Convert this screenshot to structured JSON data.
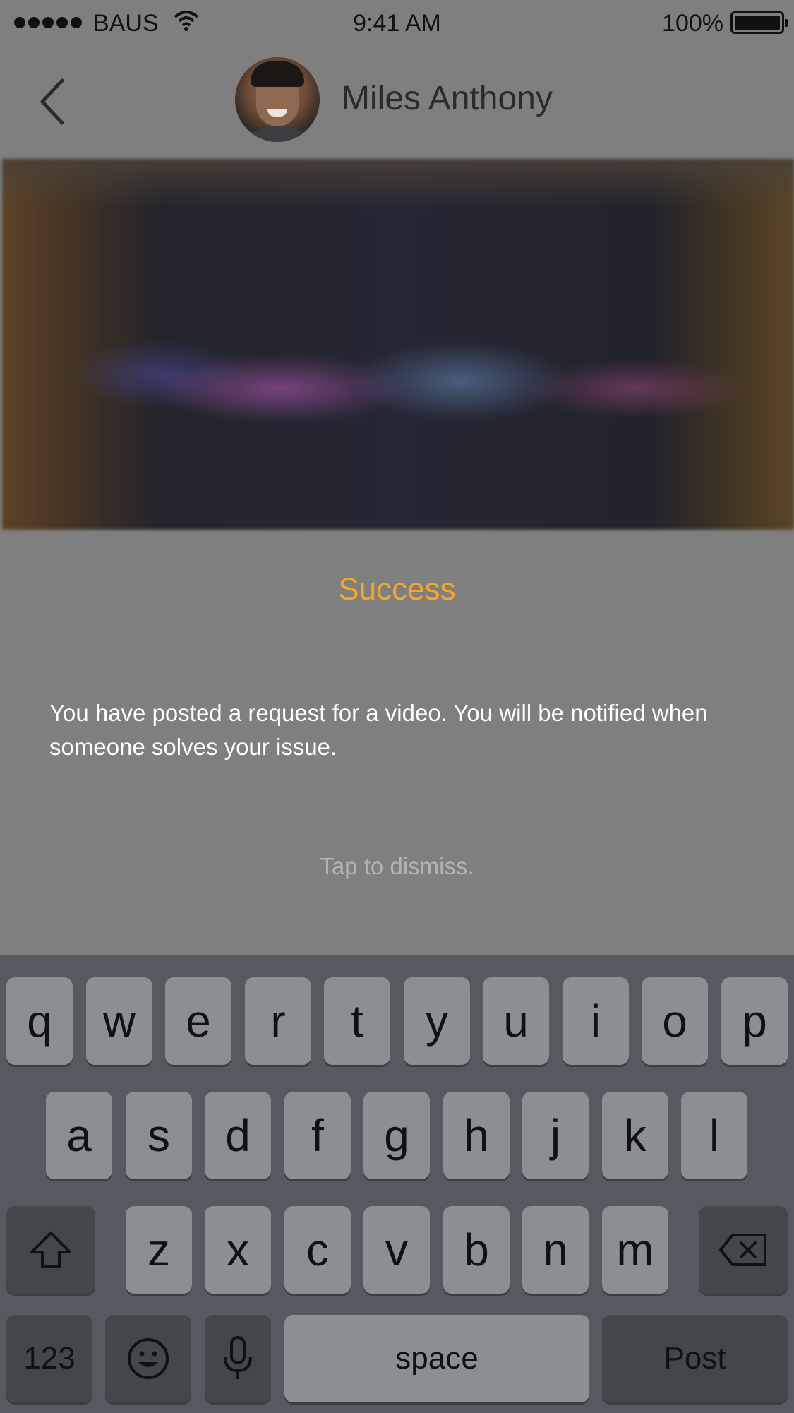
{
  "status_bar": {
    "carrier": "BAUS",
    "time": "9:41 AM",
    "battery_percent": "100%"
  },
  "nav": {
    "back_icon": "chevron-left-icon",
    "contact_name": "Miles Anthony"
  },
  "alert": {
    "title": "Success",
    "message": "You have posted a request for a video. You will be notified when someone solves your issue.",
    "dismiss_hint": "Tap to dismiss.",
    "title_color": "#f6a62a"
  },
  "keyboard": {
    "row1": [
      "q",
      "w",
      "e",
      "r",
      "t",
      "y",
      "u",
      "i",
      "o",
      "p"
    ],
    "row2": [
      "a",
      "s",
      "d",
      "f",
      "g",
      "h",
      "j",
      "k",
      "l"
    ],
    "row3": [
      "z",
      "x",
      "c",
      "v",
      "b",
      "n",
      "m"
    ],
    "numbers_label": "123",
    "space_label": "space",
    "return_label": "Post",
    "shift_icon": "shift-icon",
    "delete_icon": "backspace-icon",
    "emoji_icon": "emoji-icon",
    "mic_icon": "microphone-icon"
  }
}
